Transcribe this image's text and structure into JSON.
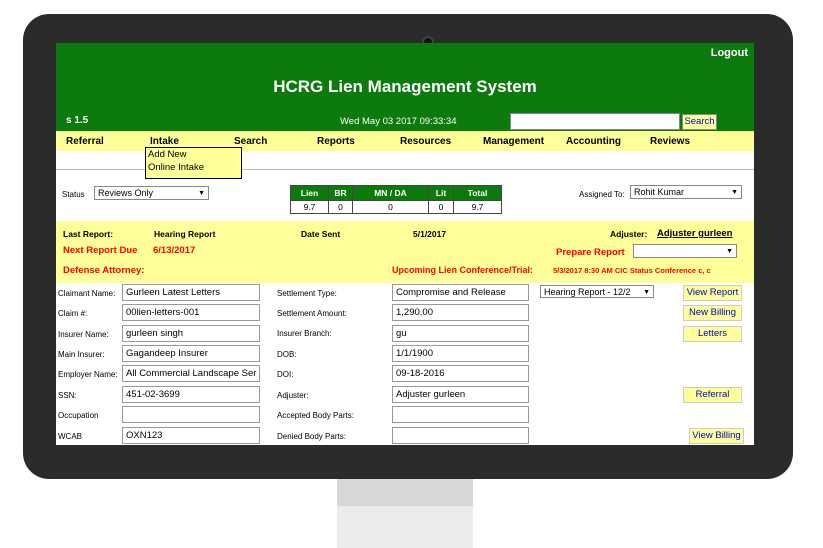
{
  "header": {
    "logout": "Logout",
    "title": "HCRG Lien Management System",
    "version": "s  1.5",
    "datetime": "Wed May 03 2017 09:33:34",
    "search_value": "",
    "search_button": "Search"
  },
  "menu": [
    "Referral",
    "Intake",
    "Search",
    "Reports",
    "Resources",
    "Management",
    "Accounting",
    "Reviews"
  ],
  "intake_dropdown": [
    "Add New",
    "Online Intake"
  ],
  "filters": {
    "status_label": "Status",
    "status_value": "Reviews Only",
    "assigned_label": "Assigned To:",
    "assigned_value": "Rohit Kumar"
  },
  "counts": {
    "headers": [
      "Lien",
      "BR",
      "MN / DA",
      "Lit",
      "Total"
    ],
    "values": [
      "9.7",
      "0",
      "0",
      "0",
      "9.7"
    ]
  },
  "report": {
    "last_report_label": "Last Report:",
    "last_report_value": "Hearing Report",
    "date_sent_label": "Date Sent",
    "date_sent_value": "5/1/2017",
    "adjuster_label": "Adjuster:",
    "adjuster_value": "Adjuster gurleen",
    "next_due_label": "Next Report Due",
    "next_due_value": "6/13/2017",
    "prepare_label": "Prepare Report",
    "prepare_value": "",
    "defense_label": "Defense Attorney:",
    "upcoming_label": "Upcoming Lien Conference/Trial:",
    "upcoming_value": "5/3/2017 8:30 AM CIC Status Conference c, c"
  },
  "form": {
    "left": [
      {
        "label": "Claimant Name:",
        "value": "Gurleen Latest Letters"
      },
      {
        "label": "Claim #:",
        "value": "00lien-letters-001"
      },
      {
        "label": "Insurer Name:",
        "value": "gurleen singh"
      },
      {
        "label": "Main Insurer:",
        "value": "Gagandeep Insurer"
      },
      {
        "label": "Employer Name:",
        "value": "All Commercial Landscape Ser"
      },
      {
        "label": "SSN:",
        "value": "451-02-3699"
      },
      {
        "label": "Occupation",
        "value": ""
      },
      {
        "label": "WCAB",
        "value": "OXN123"
      }
    ],
    "right": [
      {
        "label": "Settlement Type:",
        "value": "Compromise and Release"
      },
      {
        "label": "Settlement Amount:",
        "value": "1,290.00"
      },
      {
        "label": "Insurer Branch:",
        "value": "gu"
      },
      {
        "label": "DOB:",
        "value": "1/1/1900"
      },
      {
        "label": "DOI:",
        "value": "09-18-2016"
      },
      {
        "label": "Adjuster:",
        "value": "Adjuster gurleen"
      },
      {
        "label": "Accepted Body Parts:",
        "value": ""
      },
      {
        "label": "Denied Body Parts:",
        "value": ""
      }
    ],
    "report_select": "Hearing Report - 12/2",
    "buttons": {
      "view_report": "View Report",
      "new_billing": "New Billing",
      "letters": "Letters",
      "referral": "Referral",
      "view_billing": "View Billing"
    }
  },
  "colors": {
    "header_green": "#0c7a0c",
    "menu_yellow": "#ffff99",
    "alert_red": "#ff0000",
    "link_blue": "#0000cc"
  }
}
